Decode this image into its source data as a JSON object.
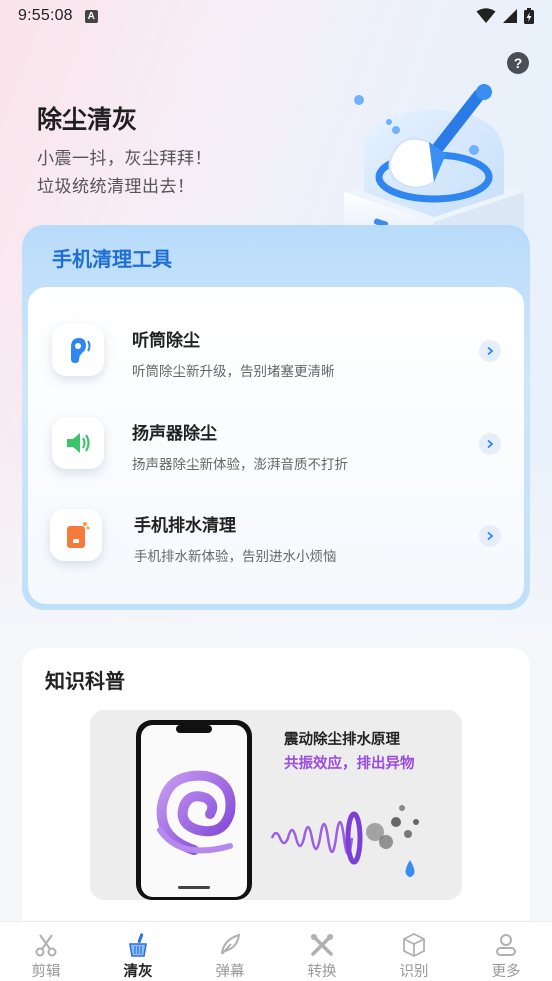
{
  "status_bar": {
    "time": "9:55:08",
    "notif_glyph": "A"
  },
  "help_button": {
    "glyph": "?"
  },
  "hero": {
    "title": "除尘清灰",
    "subtitle_line1": "小震一抖，灰尘拜拜！",
    "subtitle_line2": "垃圾统统清理出去！"
  },
  "tools": {
    "title": "手机清理工具",
    "items": [
      {
        "name": "听筒除尘",
        "desc": "听筒除尘新升级，告别堵塞更清晰",
        "icon": "ear-icon"
      },
      {
        "name": "扬声器除尘",
        "desc": "扬声器除尘新体验，澎湃音质不打折",
        "icon": "speaker-icon"
      },
      {
        "name": "手机排水清理",
        "desc": "手机排水新体验，告别进水小烦恼",
        "icon": "water-drain-icon"
      }
    ]
  },
  "knowledge": {
    "title": "知识科普",
    "banner_title": "震动除尘排水原理",
    "banner_subtitle": "共振效应，排出异物"
  },
  "tab_bar": {
    "active_index": 1,
    "active_color": "#2b6fe0",
    "tabs": [
      {
        "label": "剪辑",
        "icon": "scissors-icon"
      },
      {
        "label": "清灰",
        "icon": "brush-icon"
      },
      {
        "label": "弹幕",
        "icon": "feather-icon"
      },
      {
        "label": "转换",
        "icon": "tools-icon"
      },
      {
        "label": "识别",
        "icon": "cube-icon"
      },
      {
        "label": "更多",
        "icon": "person-icon"
      }
    ]
  }
}
